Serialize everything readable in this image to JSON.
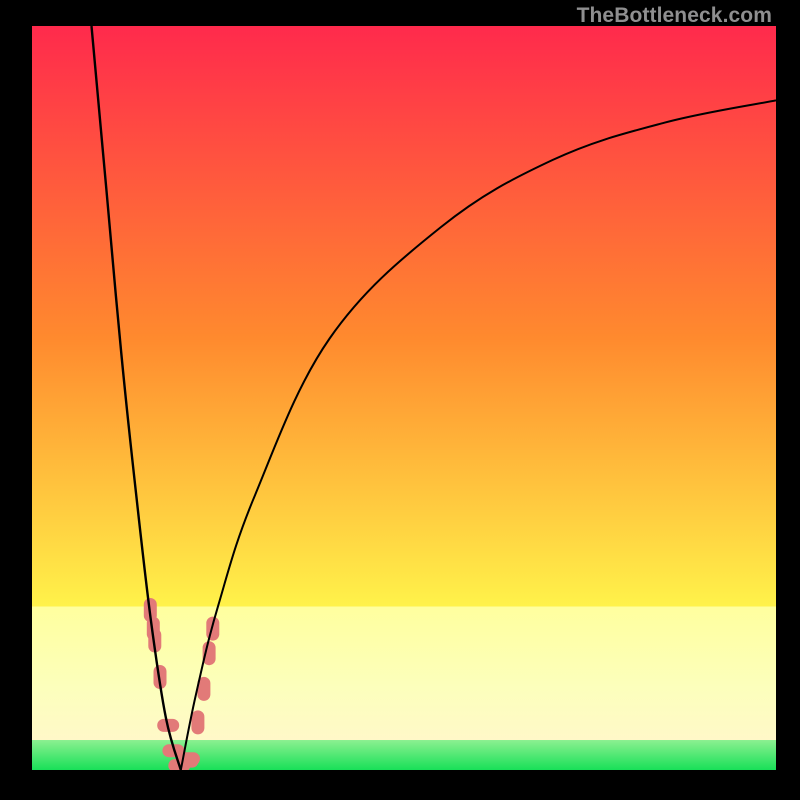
{
  "watermark": {
    "text": "TheBottleneck.com"
  },
  "colors": {
    "top": "#ff2a4c",
    "mid1": "#ff8a2e",
    "mid2": "#fff24a",
    "low_band_top": "#ffff9e",
    "low_band_mid": "#fcffbc",
    "green": "#18e058",
    "curve": "#000000",
    "marker": "#e27a78"
  },
  "chart_data": {
    "type": "line",
    "title": "",
    "xlabel": "",
    "ylabel": "",
    "xlim": [
      0,
      100
    ],
    "ylim": [
      0,
      100
    ],
    "x_optimum": 20,
    "green_band": [
      0,
      4
    ],
    "pale_band": [
      4,
      22
    ],
    "series": [
      {
        "name": "left-branch",
        "x": [
          8,
          10,
          12,
          14,
          16,
          18,
          20
        ],
        "values": [
          100,
          78,
          56,
          37,
          20,
          7,
          0
        ]
      },
      {
        "name": "right-branch",
        "x": [
          20,
          22,
          25,
          30,
          40,
          55,
          70,
          85,
          100
        ],
        "values": [
          0,
          10,
          22,
          37,
          58,
          73,
          82,
          87,
          90
        ]
      }
    ],
    "markers": {
      "name": "highlighted-points",
      "x": [
        15.9,
        16.3,
        16.5,
        17.2,
        18.3,
        19.0,
        19.8,
        20.9,
        21.1,
        22.3,
        23.1,
        23.8,
        24.3
      ],
      "y": [
        21.5,
        19.0,
        17.4,
        12.5,
        6.0,
        2.6,
        0.6,
        1.2,
        1.5,
        6.4,
        10.9,
        15.7,
        19.0
      ]
    }
  }
}
